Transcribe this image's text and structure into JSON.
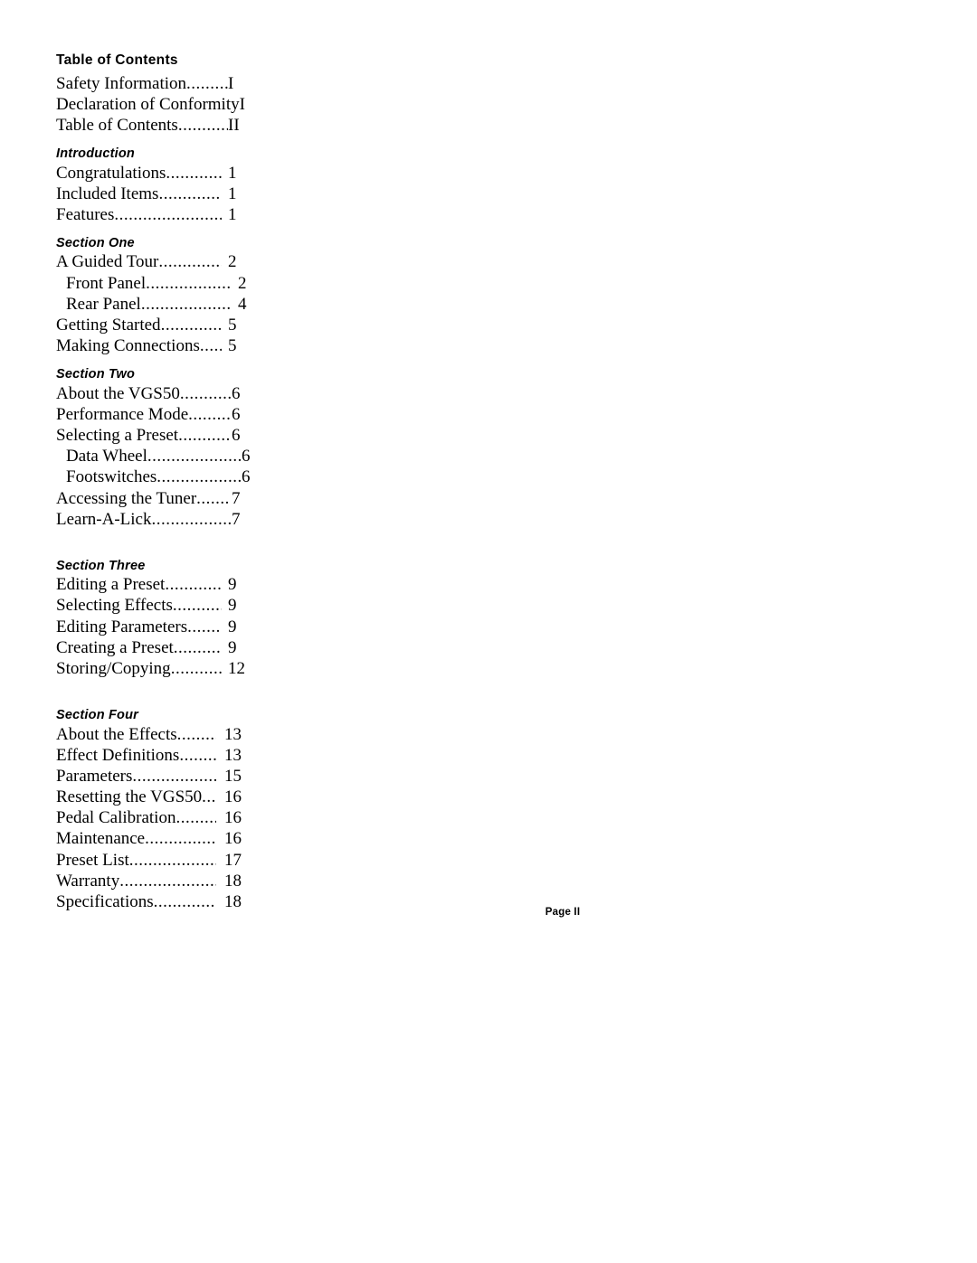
{
  "document": {
    "title": "Table of Contents",
    "footer": "Page II"
  },
  "front_matter": {
    "entries": [
      {
        "title": "Safety Information",
        "page": "I"
      },
      {
        "title": "Declaration of Conformity",
        "page": "I"
      },
      {
        "title": "Table of Contents",
        "page": "II"
      }
    ]
  },
  "sections": [
    {
      "heading": "Introduction",
      "entries": [
        {
          "title": "Congratulations",
          "page": "1",
          "indent": false
        },
        {
          "title": "Included Items",
          "page": "1",
          "indent": false
        },
        {
          "title": "Features",
          "page": "1",
          "indent": false
        }
      ]
    },
    {
      "heading": "Section One",
      "entries": [
        {
          "title": "A Guided Tour",
          "page": "2",
          "indent": false
        },
        {
          "title": "Front Panel",
          "page": "2",
          "indent": true
        },
        {
          "title": "Rear Panel",
          "page": "4",
          "indent": true
        },
        {
          "title": "Getting Started",
          "page": "5",
          "indent": false
        },
        {
          "title": "Making Connections",
          "page": "5",
          "indent": false
        }
      ]
    },
    {
      "heading": "Section Two",
      "entries": [
        {
          "title": "About the VGS50",
          "page": "6",
          "indent": false
        },
        {
          "title": "Performance Mode",
          "page": "6",
          "indent": false
        },
        {
          "title": "Selecting a Preset",
          "page": "6",
          "indent": false
        },
        {
          "title": "Data Wheel",
          "page": "6",
          "indent": true
        },
        {
          "title": "Footswitches",
          "page": "6",
          "indent": true
        },
        {
          "title": "Accessing the Tuner",
          "page": "7",
          "indent": false
        },
        {
          "title": "Learn-A-Lick",
          "page": "7",
          "indent": false
        }
      ]
    },
    {
      "heading": "Section Three",
      "entries": [
        {
          "title": "Editing a Preset",
          "page": "9",
          "indent": false
        },
        {
          "title": "Selecting Effects",
          "page": "9",
          "indent": false
        },
        {
          "title": "Editing Parameters",
          "page": "9",
          "indent": false
        },
        {
          "title": "Creating a Preset",
          "page": "9",
          "indent": false
        },
        {
          "title": "Storing/Copying",
          "page": "12",
          "indent": false
        }
      ]
    },
    {
      "heading": "Section Four",
      "entries": [
        {
          "title": "About the Effects",
          "page": "13",
          "indent": false
        },
        {
          "title": "Effect Definitions",
          "page": "13",
          "indent": false
        },
        {
          "title": "Parameters",
          "page": "15",
          "indent": false
        },
        {
          "title": "Resetting the VGS50",
          "page": "16",
          "indent": false
        },
        {
          "title": "Pedal Calibration",
          "page": "16",
          "indent": false
        },
        {
          "title": "Maintenance",
          "page": "16",
          "indent": false
        },
        {
          "title": "Preset List",
          "page": "17",
          "indent": false
        },
        {
          "title": "Warranty",
          "page": "18",
          "indent": false
        },
        {
          "title": "Specifications",
          "page": "18",
          "indent": false
        }
      ]
    }
  ]
}
